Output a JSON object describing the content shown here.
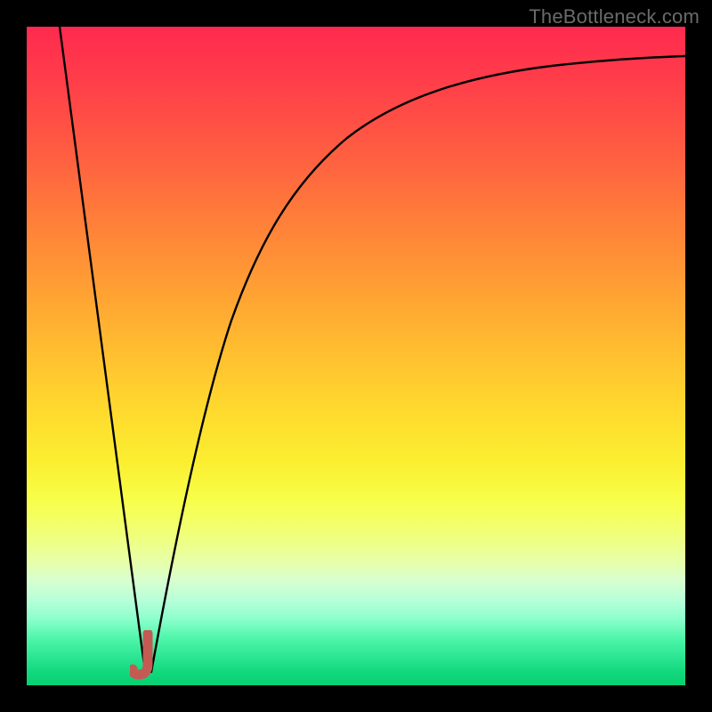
{
  "watermark": {
    "text": "TheBottleneck.com"
  },
  "chart_data": {
    "type": "line",
    "title": "",
    "xlabel": "",
    "ylabel": "",
    "xlim": [
      0,
      100
    ],
    "ylim": [
      0,
      100
    ],
    "grid": false,
    "legend": false,
    "series": [
      {
        "name": "left-ray",
        "color": "#000000",
        "x": [
          5,
          18
        ],
        "y": [
          100,
          2
        ]
      },
      {
        "name": "right-curve",
        "color": "#000000",
        "x": [
          19,
          22,
          26,
          30,
          35,
          40,
          48,
          58,
          70,
          85,
          100
        ],
        "y": [
          2,
          20,
          40,
          55,
          67,
          75,
          82,
          87,
          90,
          92,
          93
        ]
      }
    ],
    "marker": {
      "name": "optimum",
      "shape": "J",
      "color": "#c45a54",
      "x": 18,
      "y": 2
    },
    "background": {
      "type": "vertical-gradient",
      "stops": [
        {
          "pos": 0,
          "color": "#ff2a4f"
        },
        {
          "pos": 50,
          "color": "#ffd22e"
        },
        {
          "pos": 75,
          "color": "#f6ff56"
        },
        {
          "pos": 100,
          "color": "#08d173"
        }
      ]
    }
  }
}
